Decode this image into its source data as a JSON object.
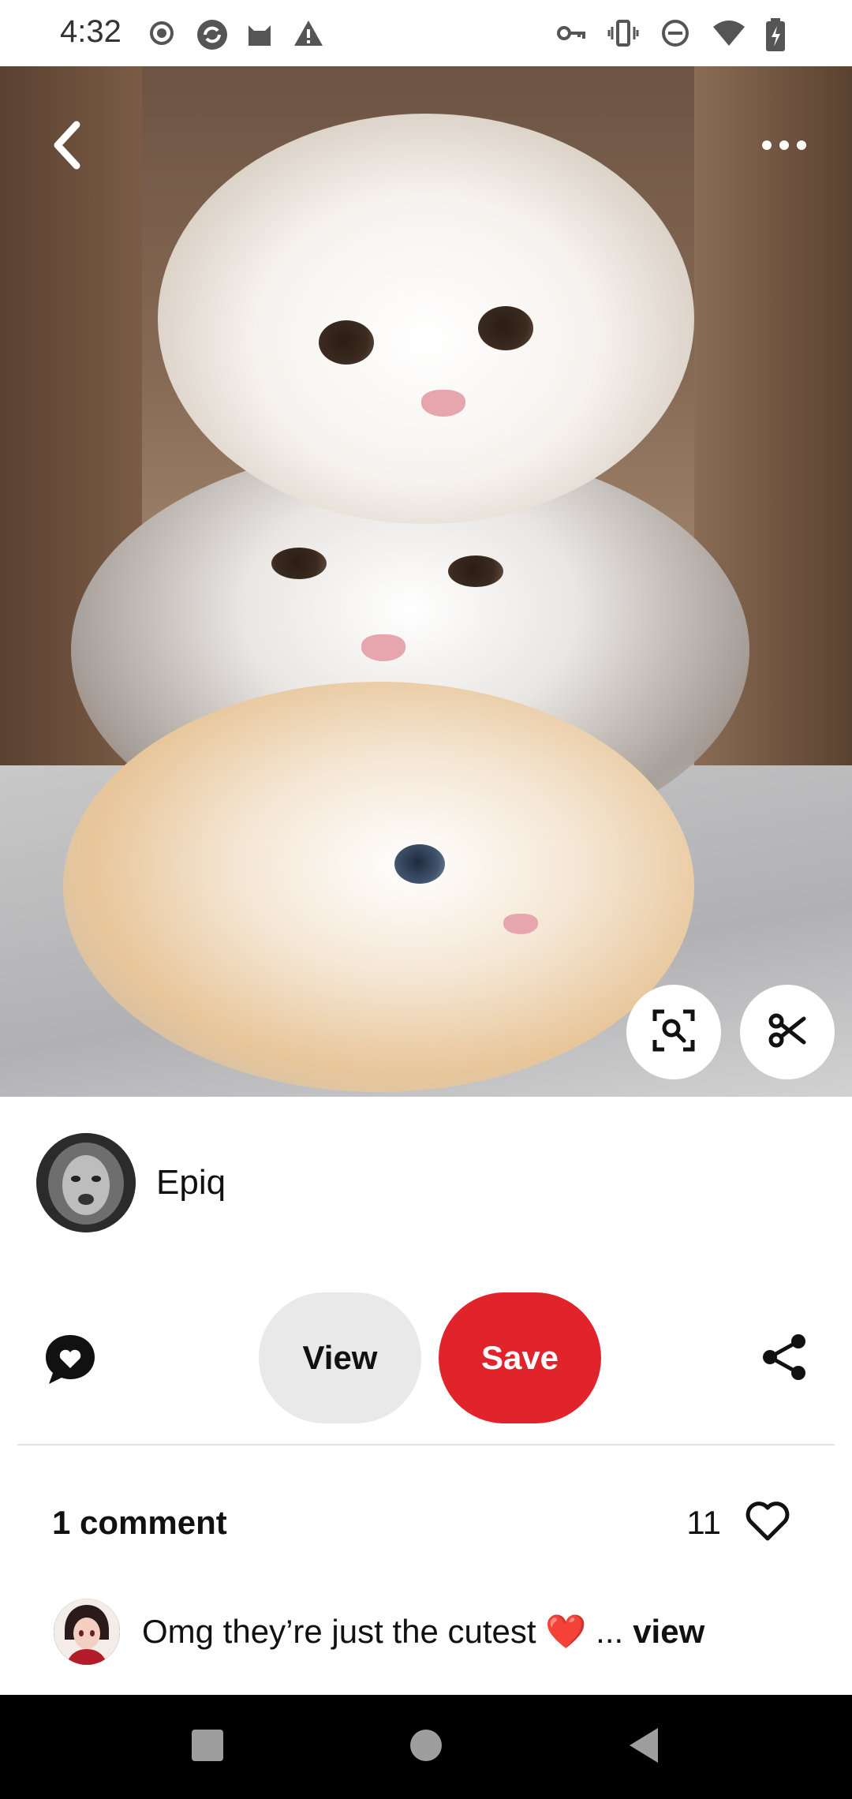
{
  "status_bar": {
    "time": "4:32",
    "left_icons": [
      "record-icon",
      "sync-icon",
      "cat-app-icon",
      "warning-icon"
    ],
    "right_icons": [
      "vpn-key-icon",
      "vibrate-icon",
      "do-not-disturb-icon",
      "wifi-icon",
      "battery-charging-icon"
    ]
  },
  "photo": {
    "subject": "cat-stack-photo",
    "back_icon": "chevron-left-icon",
    "more_icon": "more-horizontal-icon",
    "lens_icon": "visual-search-icon",
    "cut_icon": "scissors-icon"
  },
  "author": {
    "name": "Epiq",
    "avatar_icon": "lion-avatar"
  },
  "actions": {
    "comment_icon": "heart-chat-icon",
    "view_label": "View",
    "save_label": "Save",
    "share_icon": "share-icon",
    "save_color": "#e1232b"
  },
  "comments": {
    "count_label": "1 comment",
    "like_count": "11",
    "items": [
      {
        "text": "Omg they’re just the cutest ❤️ ...",
        "more_label": "view"
      }
    ]
  },
  "nav": {
    "icons": [
      "recents-icon",
      "home-icon",
      "back-icon"
    ]
  }
}
